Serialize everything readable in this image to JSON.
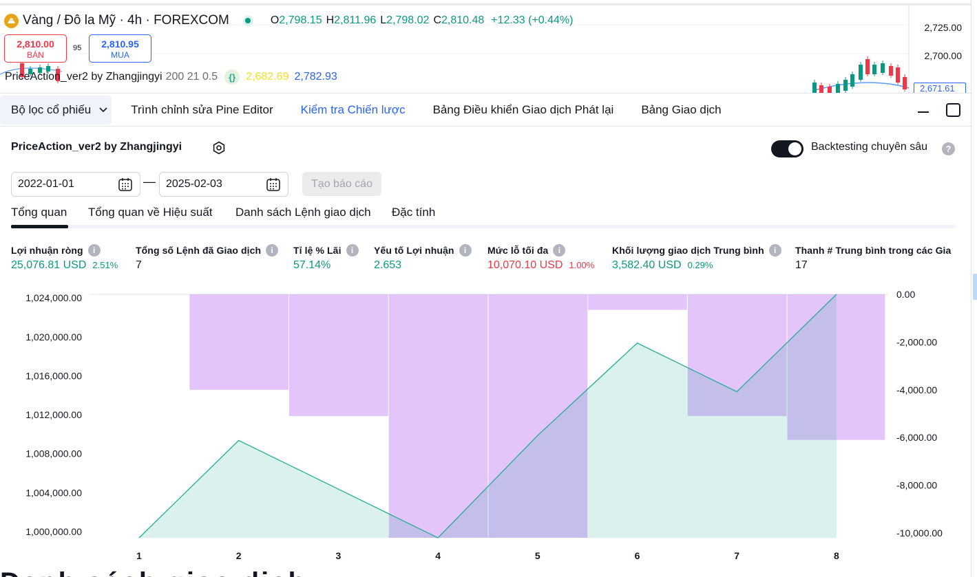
{
  "symbol": {
    "name": "Vàng / Đô la Mỹ · 4h · FOREXCOM",
    "ohlc": [
      {
        "k": "O",
        "v": "2,798.15"
      },
      {
        "k": "H",
        "v": "2,811.96"
      },
      {
        "k": "L",
        "v": "2,798.02"
      },
      {
        "k": "C",
        "v": "2,810.48"
      }
    ],
    "change": "+12.33 (+0.44%)"
  },
  "trade": {
    "sell_price": "2,810.00",
    "sell_label": "BÁN",
    "spread": "95",
    "buy_price": "2,810.95",
    "buy_label": "MUA"
  },
  "indicator": {
    "name": "PriceAction_ver2 by Zhangjingyi",
    "params": "200 21 0.5",
    "braces": "{}",
    "value1": "2,682.69",
    "value2": "2,782.93"
  },
  "price_axis": {
    "labels": [
      "2,725.00",
      "2,700.00"
    ],
    "tag": "2,671.61"
  },
  "tabs": [
    {
      "label": "Bộ lọc cổ phiếu"
    },
    {
      "label": "Trình chỉnh sửa Pine Editor"
    },
    {
      "label": "Kiểm tra Chiến lược"
    },
    {
      "label": "Bảng Điều khiển Giao dịch Phát lại"
    },
    {
      "label": "Bảng Giao dịch"
    }
  ],
  "strategy": {
    "title": "PriceAction_ver2 by Zhangjingyi",
    "deep_label": "Backtesting chuyên sâu",
    "date_from": "2022-01-01",
    "date_sep": "—",
    "date_to": "2025-02-03",
    "report_button": "Tạo báo cáo",
    "subtabs": [
      "Tổng quan",
      "Tổng quan về Hiệu suất",
      "Danh sách Lệnh giao dịch",
      "Đặc tính"
    ]
  },
  "metrics": [
    {
      "label": "Lợi nhuận ròng",
      "value": "25,076.81 USD",
      "pct": "2.51%",
      "color": "#089981"
    },
    {
      "label": "Tổng số Lệnh đã Giao dịch",
      "value": "7",
      "pct": "",
      "color": "#131722"
    },
    {
      "label": "Tỉ lệ % Lãi",
      "value": "57.14%",
      "pct": "",
      "color": "#089981"
    },
    {
      "label": "Yếu tố Lợi nhuận",
      "value": "2.653",
      "pct": "",
      "color": "#089981"
    },
    {
      "label": "Mức lỗ tối đa",
      "value": "10,070.10 USD",
      "pct": "1.00%",
      "color": "#f23645"
    },
    {
      "label": "Khối lượng giao dịch Trung bình",
      "value": "3,582.40 USD",
      "pct": "0.29%",
      "color": "#089981"
    },
    {
      "label": "Thanh # Trung bình trong các Gia",
      "value": "17",
      "pct": "",
      "color": "#131722"
    }
  ],
  "chart_data": {
    "type": "area",
    "x": [
      1,
      2,
      3,
      4,
      5,
      6,
      7,
      8
    ],
    "left_axis_ticks": [
      "1,024,000.00",
      "1,020,000.00",
      "1,016,000.00",
      "1,012,000.00",
      "1,008,000.00",
      "1,004,000.00",
      "1,000,000.00"
    ],
    "right_axis_ticks": [
      "0.00",
      "-2,000.00",
      "-4,000.00",
      "-6,000.00",
      "-8,000.00",
      "-10,000.00"
    ],
    "left_ylim": [
      1000000,
      1025000
    ],
    "right_ylim": [
      -10200,
      0
    ],
    "series": [
      {
        "kind": "line-area",
        "axis": "left",
        "color": "#22ab94",
        "values": [
          1000000,
          1010000,
          1005000,
          1000000,
          1010500,
          1020000,
          1015000,
          1025000
        ]
      },
      {
        "kind": "bar-down",
        "axis": "right",
        "color": "#c27cf7",
        "values": [
          0,
          -4000,
          -5100,
          -10200,
          -10200,
          -650,
          -5100,
          -6100
        ]
      }
    ],
    "grid": false
  },
  "bottom_text": "Danh sách giao dịch"
}
